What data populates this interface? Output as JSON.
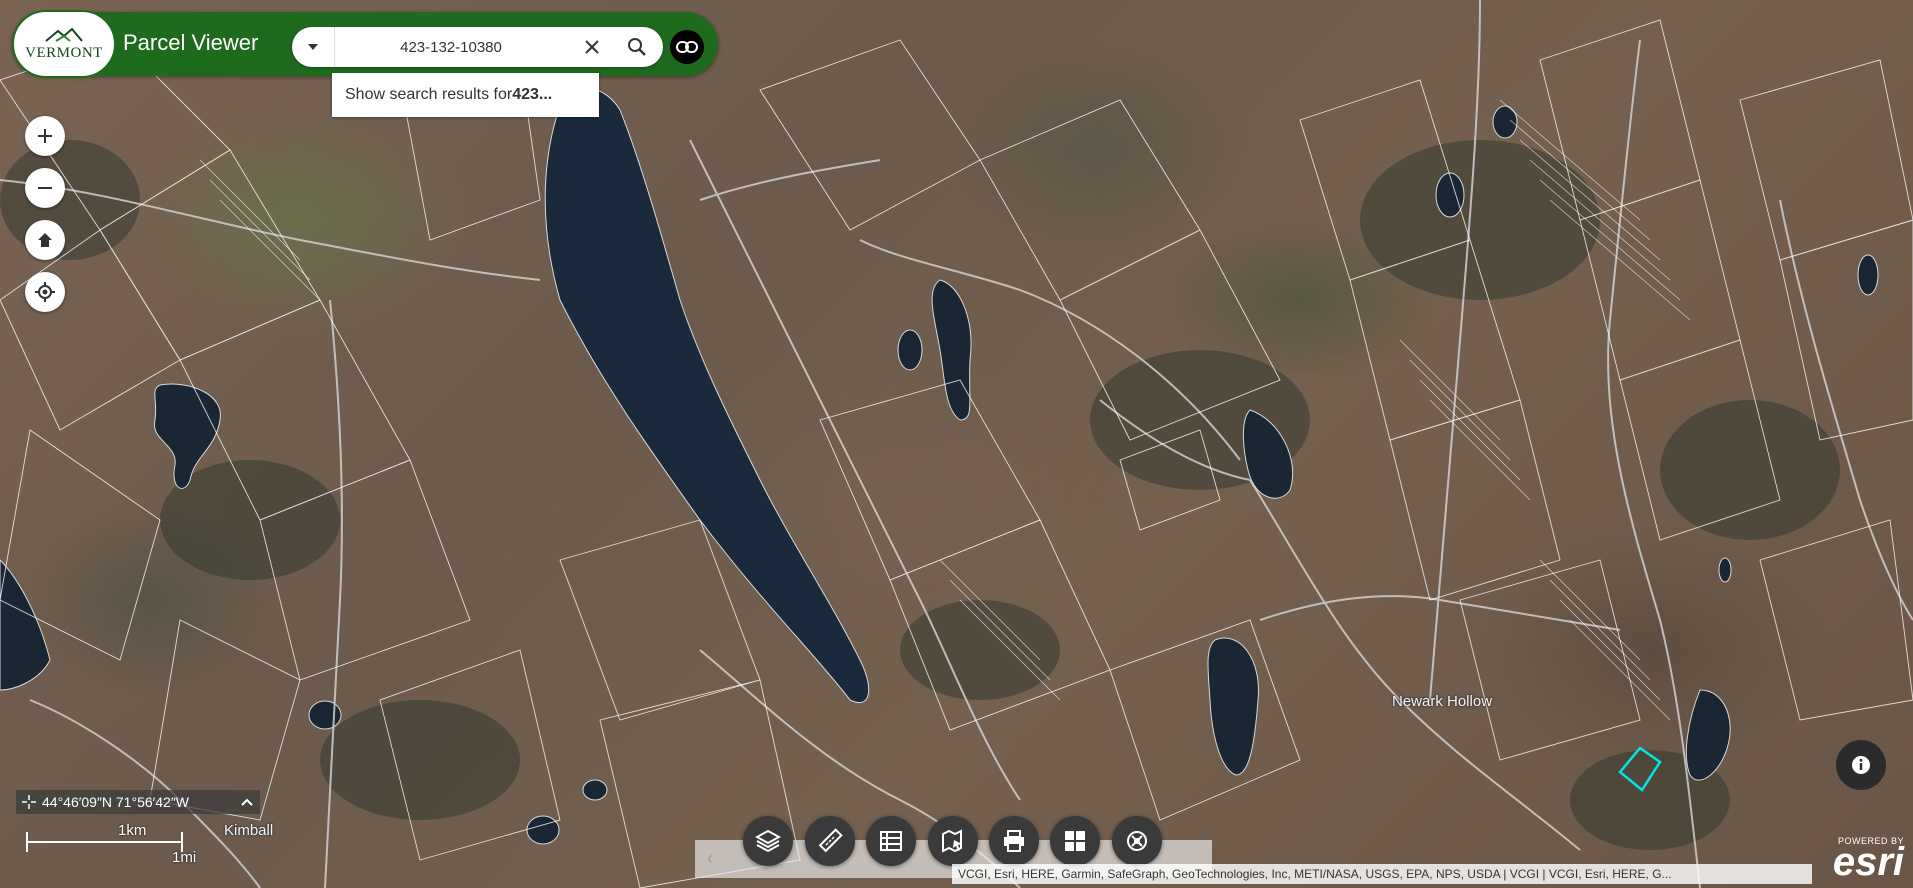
{
  "app": {
    "logo_text": "VERMONT",
    "title": "Parcel Viewer"
  },
  "search": {
    "value": "423-132-10380",
    "suggestion_prefix": "Show search results for ",
    "suggestion_term": "423..."
  },
  "map": {
    "coordinates": "44°46′09″N 71°56′42″W",
    "scale_km": "1km",
    "scale_mi": "1mi",
    "labels": {
      "newark_hollow": "Newark Hollow",
      "kimball": "Kimball"
    },
    "highlight_color": "#00e5e5"
  },
  "toolbar": {
    "items": [
      {
        "name": "layers",
        "icon": "layers-icon"
      },
      {
        "name": "measure",
        "icon": "ruler-icon"
      },
      {
        "name": "attribute-table",
        "icon": "table-icon"
      },
      {
        "name": "select",
        "icon": "select-map-icon"
      },
      {
        "name": "print",
        "icon": "printer-icon"
      },
      {
        "name": "basemap-gallery",
        "icon": "grid-icon"
      },
      {
        "name": "tools",
        "icon": "tools-icon"
      }
    ]
  },
  "attribution": "VCGI, Esri, HERE, Garmin, SafeGraph, GeoTechnologies, Inc, METI/NASA, USGS, EPA, NPS, USDA | VCGI | VCGI, Esri, HERE, G...",
  "esri": {
    "powered_by": "POWERED BY",
    "brand": "esri"
  },
  "colors": {
    "header_green": "#1e6b1e",
    "tool_button": "#3a3a3a"
  }
}
